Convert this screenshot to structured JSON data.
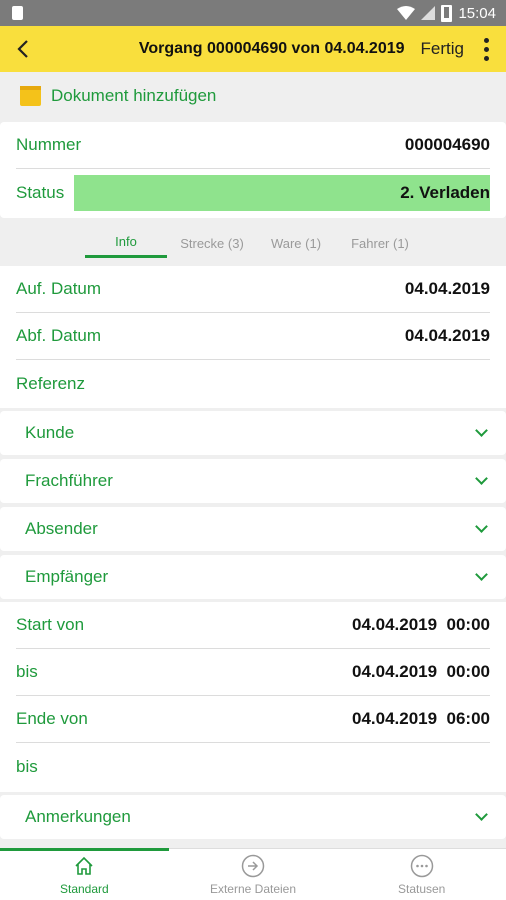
{
  "status_bar": {
    "time": "15:04"
  },
  "appbar": {
    "back_glyph": "‹",
    "title": "Vorgang 000004690 von 04.04.2019",
    "done_label": "Fertig"
  },
  "add_document": {
    "label": "Dokument hinzufügen"
  },
  "header_fields": {
    "number_label": "Nummer",
    "number_value": "000004690",
    "status_label": "Status",
    "status_value": "2. Verladen",
    "status_color": "#8fe38d"
  },
  "tabs": [
    {
      "label": "Info",
      "active": true
    },
    {
      "label": "Strecke (3)",
      "active": false
    },
    {
      "label": "Ware (1)",
      "active": false
    },
    {
      "label": "Fahrer (1)",
      "active": false
    }
  ],
  "info_fields": {
    "order_date_label": "Auf. Datum",
    "order_date_value": "04.04.2019",
    "dep_date_label": "Abf. Datum",
    "dep_date_value": "04.04.2019",
    "reference_label": "Referenz"
  },
  "sections": {
    "customer": "Kunde",
    "carrier": "Frachführer",
    "sender": "Absender",
    "recipient": "Empfänger",
    "remarks": "Anmerkungen"
  },
  "times": {
    "start_from_label": "Start von",
    "start_from_value": "04.04.2019  00:00",
    "start_to_label": "bis",
    "start_to_value": "04.04.2019  00:00",
    "end_from_label": "Ende von",
    "end_from_value": "04.04.2019  06:00",
    "end_to_label": "bis"
  },
  "bottom_nav": [
    {
      "label": "Standard",
      "icon": "home-icon",
      "active": true
    },
    {
      "label": "Externe Dateien",
      "icon": "arrow-circle-icon",
      "active": false
    },
    {
      "label": "Statusen",
      "icon": "dots-circle-icon",
      "active": false
    }
  ],
  "colors": {
    "accent": "#1f9a3c",
    "appbar": "#f9df3d"
  }
}
